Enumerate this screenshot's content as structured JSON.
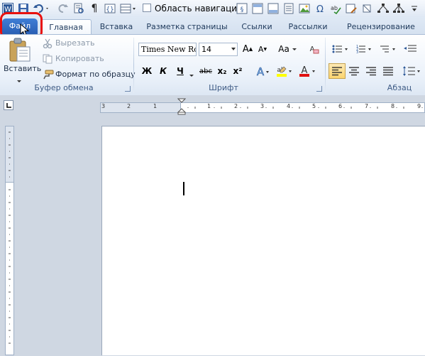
{
  "qat": {
    "word_icon": "word-app-icon",
    "nav_pane_label": "Область навигации"
  },
  "tabs": {
    "file": "Файл",
    "items": [
      "Главная",
      "Вставка",
      "Разметка страницы",
      "Ссылки",
      "Рассылки",
      "Рецензирование"
    ]
  },
  "clipboard": {
    "paste": "Вставить",
    "cut": "Вырезать",
    "copy": "Копировать",
    "format_painter": "Формат по образцу",
    "group_label": "Буфер обмена"
  },
  "font": {
    "font_name": "Times New Ro",
    "font_size": "14",
    "bold": "Ж",
    "italic": "К",
    "underline": "Ч",
    "strike": "abc",
    "subscript": "x₂",
    "superscript": "x²",
    "change_case": "Aa",
    "grow": "A",
    "shrink": "A",
    "group_label": "Шрифт"
  },
  "paragraph": {
    "group_label": "Абзац"
  },
  "ruler": {
    "numbers": [
      "3",
      "2",
      "1",
      "1",
      "2",
      "3",
      "4",
      "5",
      "6",
      "7",
      "8",
      "9"
    ]
  },
  "colors": {
    "file_tab": "#2a5fb4",
    "highlight": "#e8100e",
    "font_color": "#e01010",
    "highlight_color": "#ffff00"
  }
}
